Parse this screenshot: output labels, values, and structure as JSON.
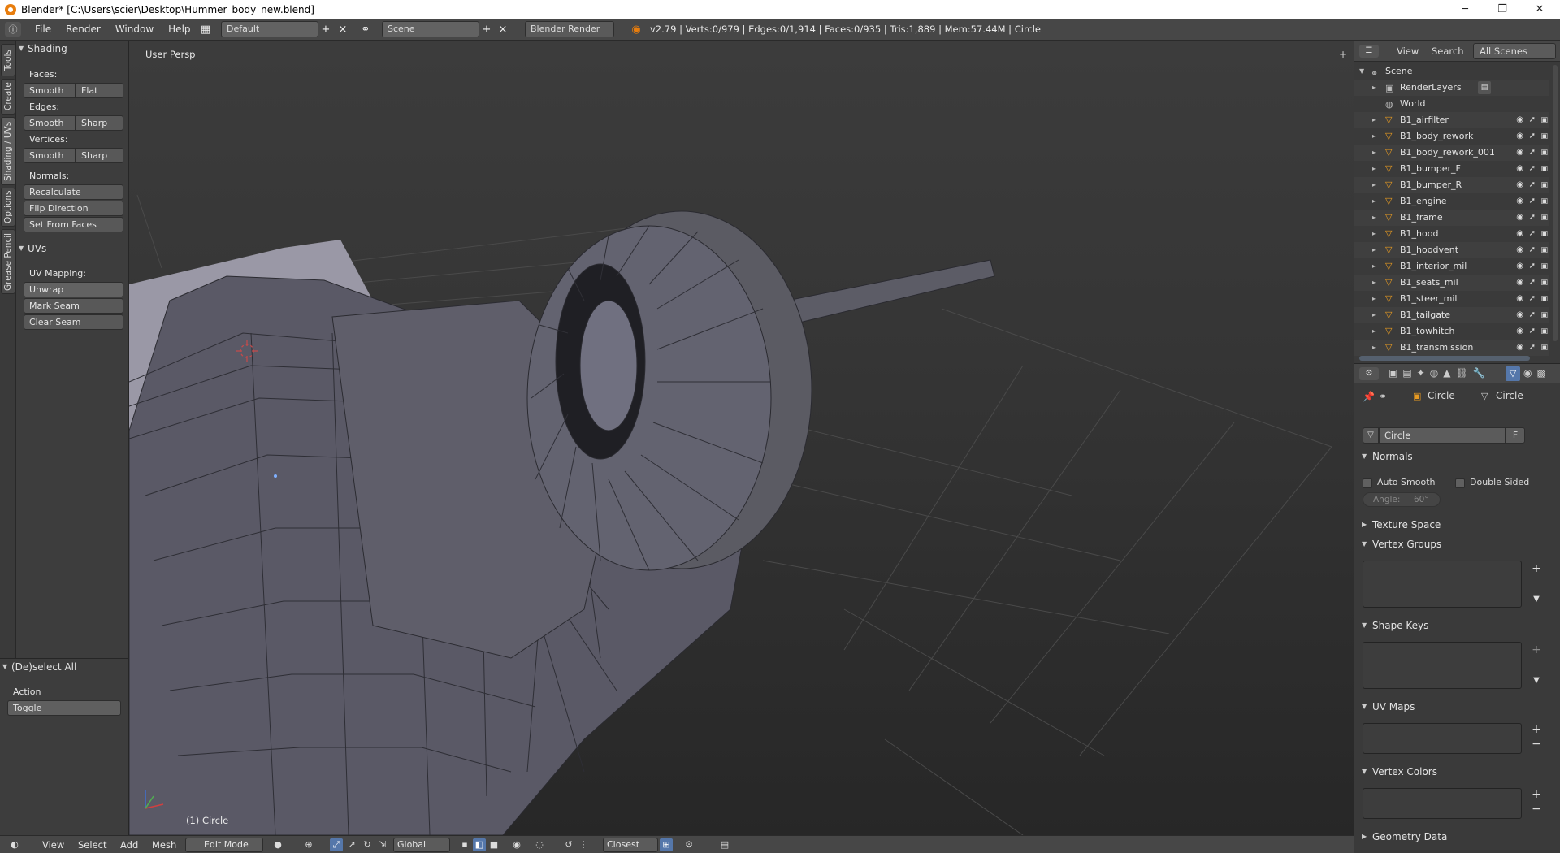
{
  "window": {
    "title": "Blender* [C:\\Users\\scier\\Desktop\\Hummer_body_new.blend]",
    "min_glyph": "─",
    "max_glyph": "❐",
    "close_glyph": "✕"
  },
  "info_header": {
    "menu": [
      "File",
      "Render",
      "Window",
      "Help"
    ],
    "screen_layout": "Default",
    "scene": "Scene",
    "render_engine": "Blender Render",
    "stats": "v2.79 | Verts:0/979 | Edges:0/1,914 | Faces:0/935 | Tris:1,889 | Mem:57.44M | Circle"
  },
  "tool_tabs": [
    "Tools",
    "Create",
    "Shading / UVs",
    "Options",
    "Grease Pencil"
  ],
  "tool_shelf": {
    "shading_panel": "Shading",
    "faces_label": "Faces:",
    "faces_smooth": "Smooth",
    "faces_flat": "Flat",
    "edges_label": "Edges:",
    "edges_smooth": "Smooth",
    "edges_sharp": "Sharp",
    "vertices_label": "Vertices:",
    "vertices_smooth": "Smooth",
    "vertices_sharp": "Sharp",
    "normals_label": "Normals:",
    "recalculate": "Recalculate",
    "flip_direction": "Flip Direction",
    "set_from_faces": "Set From Faces",
    "uvs_panel": "UVs",
    "uv_mapping_label": "UV Mapping:",
    "unwrap": "Unwrap",
    "mark_seam": "Mark Seam",
    "clear_seam": "Clear Seam"
  },
  "operator_panel": {
    "title": "(De)select All",
    "action_label": "Action",
    "action_value": "Toggle"
  },
  "viewport": {
    "view_name": "User Persp",
    "active_object": "(1) Circle"
  },
  "bottom_header": {
    "menus": [
      "View",
      "Select",
      "Add",
      "Mesh"
    ],
    "mode": "Edit Mode",
    "orientation": "Global",
    "snap_target": "Closest"
  },
  "outliner": {
    "header": [
      "View",
      "Search",
      "All Scenes"
    ],
    "scene": "Scene",
    "render_layers": "RenderLayers",
    "world": "World",
    "objects": [
      "B1_airfilter",
      "B1_body_rework",
      "B1_body_rework_001",
      "B1_bumper_F",
      "B1_bumper_R",
      "B1_engine",
      "B1_frame",
      "B1_hood",
      "B1_hoodvent",
      "B1_interior_mil",
      "B1_seats_mil",
      "B1_steer_mil",
      "B1_tailgate",
      "B1_towhitch",
      "B1_transmission"
    ]
  },
  "properties": {
    "breadcrumb_object": "Circle",
    "breadcrumb_mesh": "Circle",
    "datablock_name": "Circle",
    "fake_user": "F",
    "normals_panel": "Normals",
    "auto_smooth": "Auto Smooth",
    "double_sided": "Double Sided",
    "angle": "Angle:",
    "angle_value": "60°",
    "texture_space": "Texture Space",
    "vertex_groups": "Vertex Groups",
    "shape_keys": "Shape Keys",
    "uv_maps": "UV Maps",
    "vertex_colors": "Vertex Colors",
    "geometry_data": "Geometry Data"
  },
  "colors": {
    "accent": "#5577aa",
    "object_icon": "#e69a22",
    "mesh_fill": "#5e5e68"
  }
}
